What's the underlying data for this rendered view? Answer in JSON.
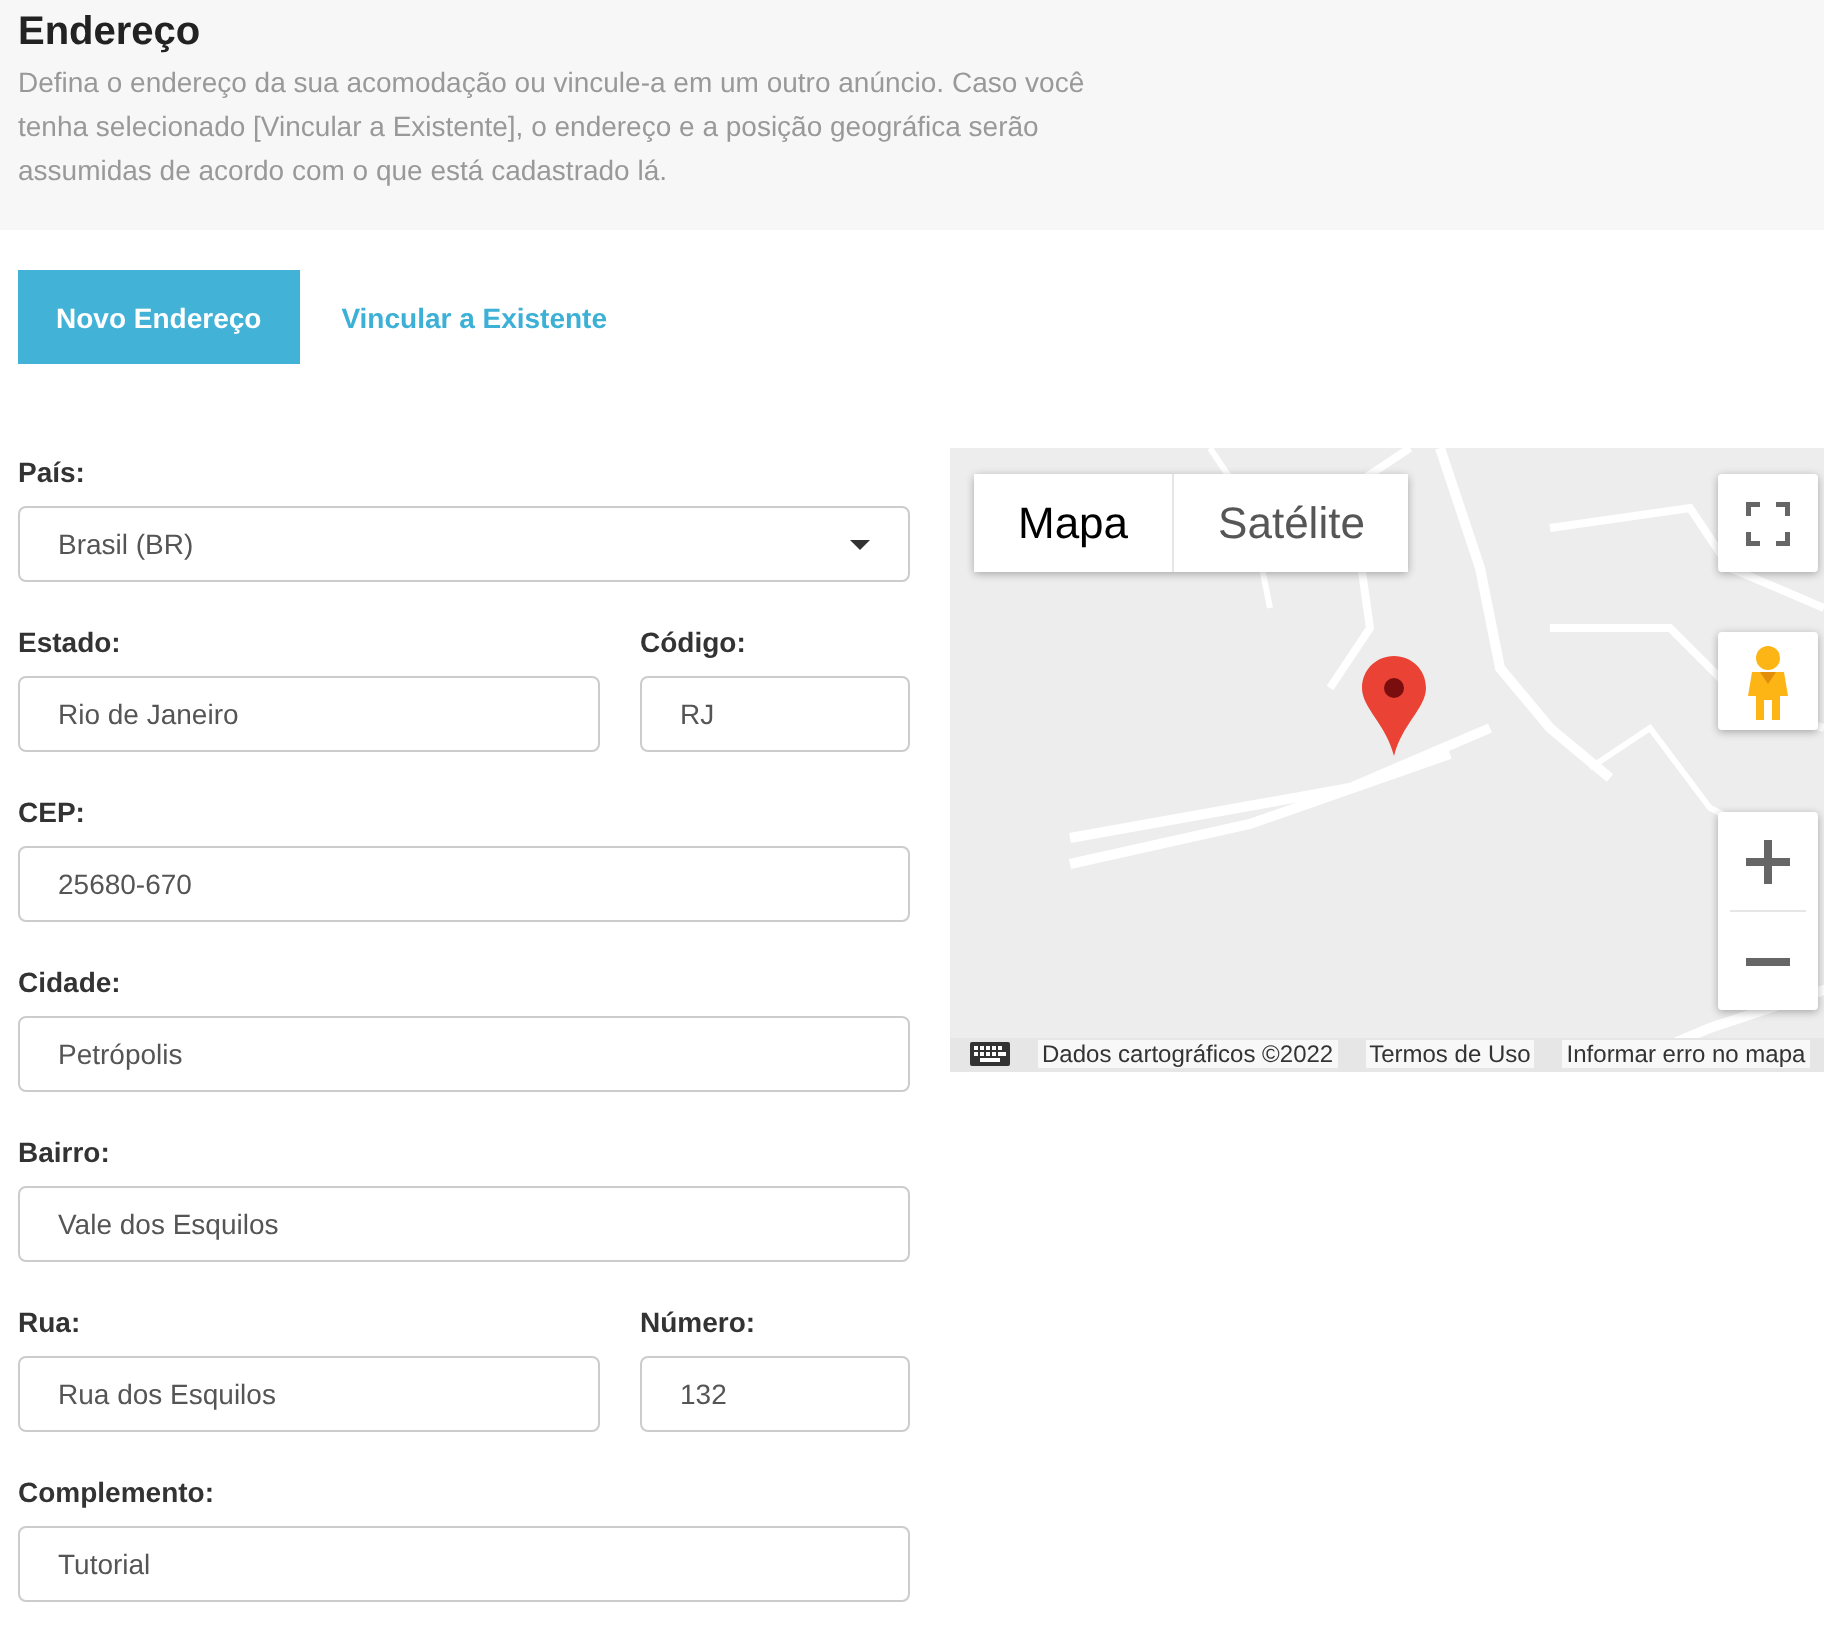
{
  "header": {
    "title": "Endereço",
    "description": "Defina o endereço da sua acomodação ou vincule-a em um outro anúncio. Caso você tenha selecionado [Vincular a Existente], o endereço e a posição geográfica serão assumidas de acordo com o que está cadastrado lá."
  },
  "tabs": [
    {
      "label": "Novo Endereço",
      "selected": true
    },
    {
      "label": "Vincular a Existente",
      "selected": false
    }
  ],
  "sections": [
    {
      "rows": [
        [
          {
            "label": "País:",
            "kind": "select",
            "value": "Brasil (BR)"
          }
        ],
        [
          {
            "label": "Estado:",
            "kind": "text",
            "value": "Rio de Janeiro"
          },
          {
            "label": "Código:",
            "kind": "text",
            "value": "RJ"
          }
        ],
        [
          {
            "label": "CEP:",
            "kind": "text",
            "value": "25680-670"
          }
        ]
      ]
    },
    {
      "rows": [
        [
          {
            "label": "Cidade:",
            "kind": "text",
            "value": "Petrópolis"
          }
        ],
        [
          {
            "label": "Bairro:",
            "kind": "text",
            "value": "Vale dos Esquilos"
          }
        ],
        [
          {
            "label": "Rua:",
            "kind": "text",
            "value": "Rua dos Esquilos"
          },
          {
            "label": "Número:",
            "kind": "text",
            "value": "132"
          }
        ],
        [
          {
            "label": "Complemento:",
            "kind": "text",
            "value": "Tutorial"
          }
        ]
      ]
    }
  ],
  "map": {
    "kind": "picture",
    "map_types": [
      {
        "label": "Mapa",
        "selected": true
      },
      {
        "label": "Satélite",
        "selected": false
      }
    ],
    "attribution": [
      "Dados cartográficos ©2022",
      "Termos de Uso",
      "Informar erro no mapa"
    ]
  }
}
